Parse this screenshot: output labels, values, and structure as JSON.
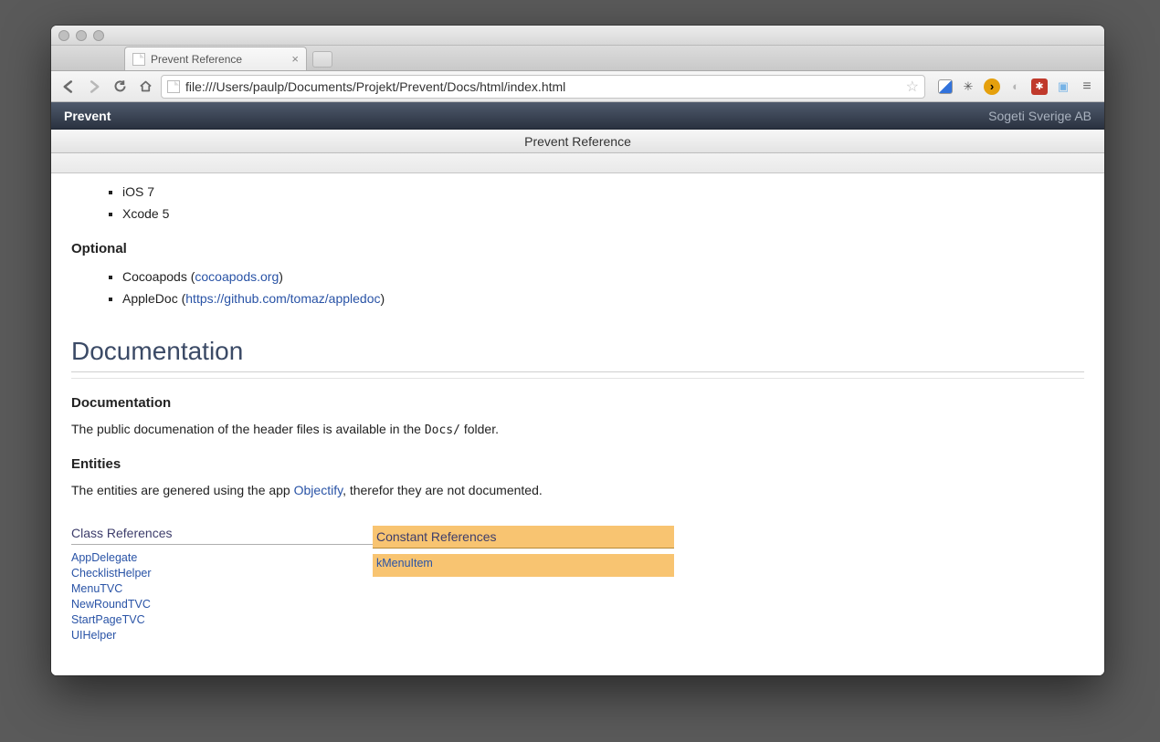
{
  "browser": {
    "tab_title": "Prevent Reference",
    "url": "file:///Users/paulp/Documents/Projekt/Prevent/Docs/html/index.html"
  },
  "header": {
    "app_name": "Prevent",
    "company": "Sogeti Sverige AB",
    "subtitle": "Prevent Reference"
  },
  "reqs": {
    "items": [
      "iOS 7",
      "Xcode 5"
    ]
  },
  "optional": {
    "heading": "Optional",
    "item1_prefix": "Cocoapods (",
    "item1_link": "cocoapods.org",
    "item1_suffix": ")",
    "item2_prefix": "AppleDoc (",
    "item2_link": "https://github.com/tomaz/appledoc",
    "item2_suffix": ")"
  },
  "doc": {
    "big": "Documentation",
    "h_doc": "Documentation",
    "p_doc_a": "The public documenation of the header files is available in the ",
    "p_doc_code": "Docs/",
    "p_doc_b": " folder.",
    "h_ent": "Entities",
    "p_ent_a": "The entities are genered using the app ",
    "p_ent_link": "Objectify",
    "p_ent_b": ", therefor they are not documented."
  },
  "refs": {
    "class_h": "Class References",
    "class_items": [
      "AppDelegate",
      "ChecklistHelper",
      "MenuTVC",
      "NewRoundTVC",
      "StartPageTVC",
      "UIHelper"
    ],
    "const_h": "Constant References",
    "const_items": [
      "kMenuItem"
    ]
  }
}
